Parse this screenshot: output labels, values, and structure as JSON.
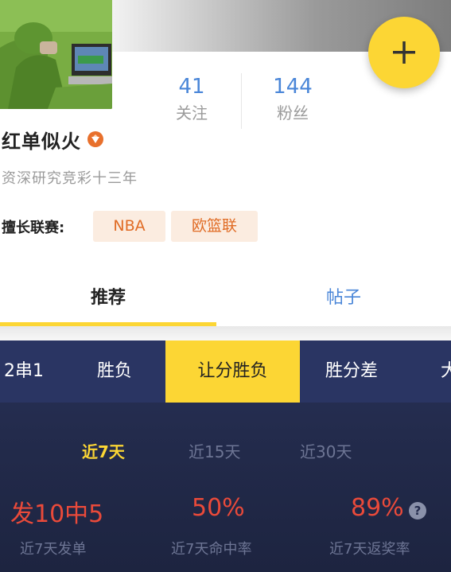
{
  "profile": {
    "name": "红单似火",
    "bio": "资深研究竞彩十三年",
    "stats": [
      {
        "value": "41",
        "label": "关注"
      },
      {
        "value": "144",
        "label": "粉丝"
      }
    ],
    "league_label": "擅长联赛:",
    "leagues": [
      "NBA",
      "欧篮联"
    ],
    "badge_icon": "verified-badge-icon",
    "follow_icon": "plus-icon"
  },
  "tabs": [
    {
      "label": "推荐",
      "active": true
    },
    {
      "label": "帖子",
      "active": false
    }
  ],
  "categories": [
    "2串1",
    "胜负",
    "让分胜负",
    "胜分差",
    "大"
  ],
  "active_category": "让分胜负",
  "periods": [
    "近7天",
    "近15天",
    "近30天"
  ],
  "active_period": "近7天",
  "metrics": [
    {
      "value": "发10中5",
      "label": "近7天发单"
    },
    {
      "value": "50%",
      "label": "近7天命中率"
    },
    {
      "value": "89%",
      "label": "近7天返奖率"
    }
  ],
  "help_glyph": "?",
  "colors": {
    "accent_yellow": "#fcd634",
    "link_blue": "#4a86d8",
    "tag_orange": "#e06b24",
    "metric_red": "#ea4a3a",
    "panel_navy": "#232b4c"
  }
}
